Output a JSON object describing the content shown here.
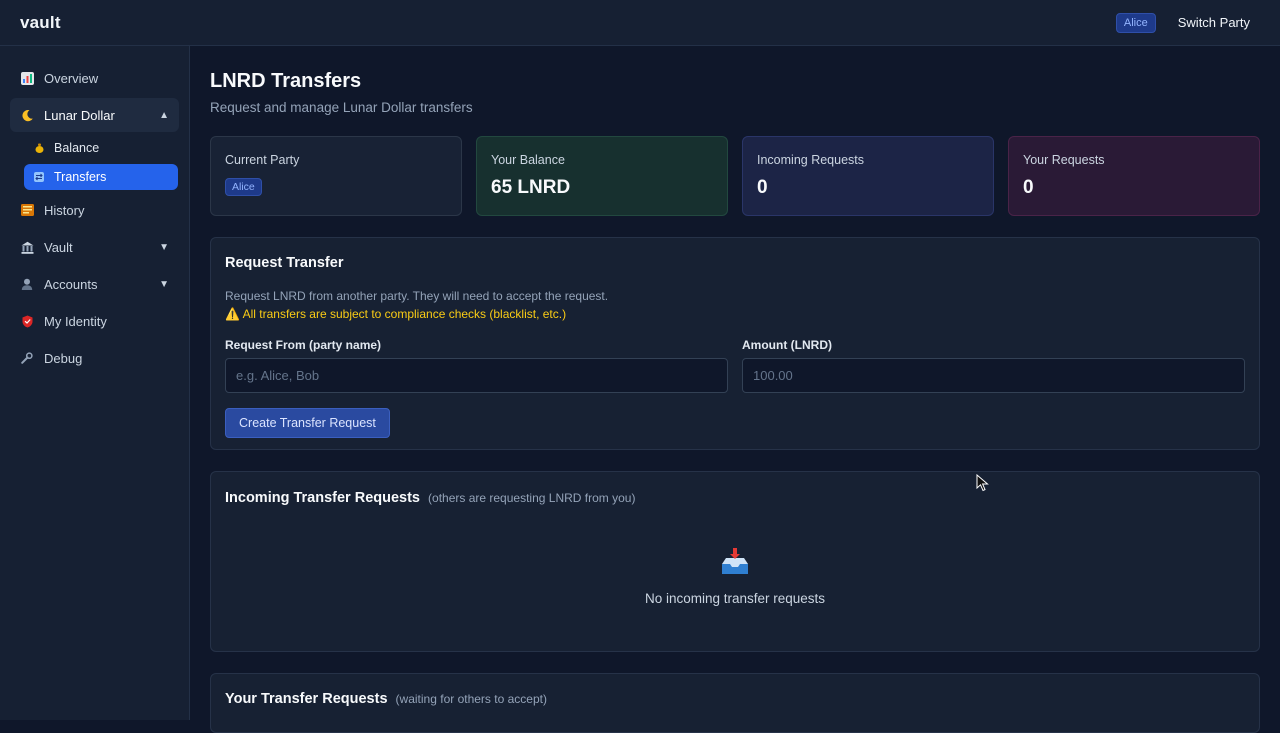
{
  "app": {
    "brand": "vault"
  },
  "topbar": {
    "party": "Alice",
    "switch_label": "Switch Party"
  },
  "sidebar": {
    "items": [
      {
        "label": "Overview",
        "icon": "chart-icon"
      },
      {
        "label": "Lunar Dollar",
        "icon": "moon-icon",
        "expanded": true,
        "children": [
          {
            "label": "Balance",
            "icon": "money-bag-icon"
          },
          {
            "label": "Transfers",
            "icon": "transfer-icon",
            "active": true
          }
        ]
      },
      {
        "label": "History",
        "icon": "book-icon"
      },
      {
        "label": "Vault",
        "icon": "bank-icon"
      },
      {
        "label": "Accounts",
        "icon": "user-icon"
      },
      {
        "label": "My Identity",
        "icon": "shield-icon"
      },
      {
        "label": "Debug",
        "icon": "wrench-icon"
      }
    ]
  },
  "page": {
    "title": "LNRD Transfers",
    "subtitle": "Request and manage Lunar Dollar transfers"
  },
  "stats": {
    "current_party_label": "Current Party",
    "current_party_value": "Alice",
    "balance_label": "Your Balance",
    "balance_value": "65 LNRD",
    "incoming_label": "Incoming Requests",
    "incoming_value": "0",
    "yours_label": "Your Requests",
    "yours_value": "0"
  },
  "request_form": {
    "title": "Request Transfer",
    "description": "Request LNRD from another party. They will need to accept the request.",
    "warning": "⚠️ All transfers are subject to compliance checks (blacklist, etc.)",
    "from_label": "Request From (party name)",
    "from_placeholder": "e.g. Alice, Bob",
    "amount_label": "Amount (LNRD)",
    "amount_placeholder": "100.00",
    "submit_label": "Create Transfer Request"
  },
  "incoming": {
    "title": "Incoming Transfer Requests",
    "subtitle": "(others are requesting LNRD from you)",
    "empty_text": "No incoming transfer requests",
    "empty_icon": "inbox-icon"
  },
  "yours": {
    "title": "Your Transfer Requests",
    "subtitle": "(waiting for others to accept)"
  }
}
